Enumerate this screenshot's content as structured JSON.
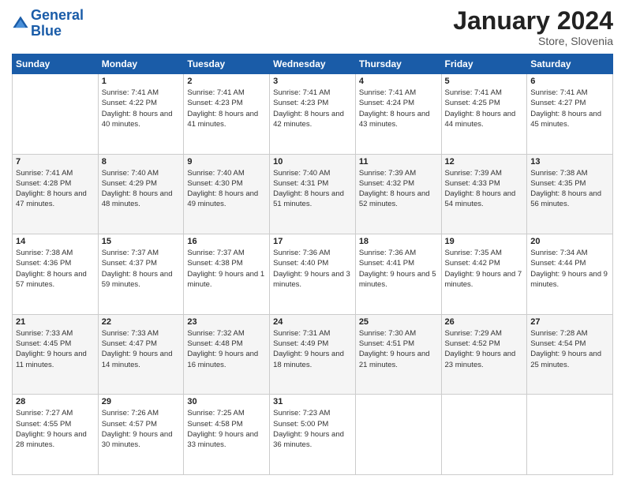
{
  "header": {
    "logo_general": "General",
    "logo_blue": "Blue",
    "month_year": "January 2024",
    "location": "Store, Slovenia"
  },
  "weekdays": [
    "Sunday",
    "Monday",
    "Tuesday",
    "Wednesday",
    "Thursday",
    "Friday",
    "Saturday"
  ],
  "weeks": [
    [
      {
        "day": "",
        "sunrise": "",
        "sunset": "",
        "daylight": ""
      },
      {
        "day": "1",
        "sunrise": "Sunrise: 7:41 AM",
        "sunset": "Sunset: 4:22 PM",
        "daylight": "Daylight: 8 hours and 40 minutes."
      },
      {
        "day": "2",
        "sunrise": "Sunrise: 7:41 AM",
        "sunset": "Sunset: 4:23 PM",
        "daylight": "Daylight: 8 hours and 41 minutes."
      },
      {
        "day": "3",
        "sunrise": "Sunrise: 7:41 AM",
        "sunset": "Sunset: 4:23 PM",
        "daylight": "Daylight: 8 hours and 42 minutes."
      },
      {
        "day": "4",
        "sunrise": "Sunrise: 7:41 AM",
        "sunset": "Sunset: 4:24 PM",
        "daylight": "Daylight: 8 hours and 43 minutes."
      },
      {
        "day": "5",
        "sunrise": "Sunrise: 7:41 AM",
        "sunset": "Sunset: 4:25 PM",
        "daylight": "Daylight: 8 hours and 44 minutes."
      },
      {
        "day": "6",
        "sunrise": "Sunrise: 7:41 AM",
        "sunset": "Sunset: 4:27 PM",
        "daylight": "Daylight: 8 hours and 45 minutes."
      }
    ],
    [
      {
        "day": "7",
        "sunrise": "Sunrise: 7:41 AM",
        "sunset": "Sunset: 4:28 PM",
        "daylight": "Daylight: 8 hours and 47 minutes."
      },
      {
        "day": "8",
        "sunrise": "Sunrise: 7:40 AM",
        "sunset": "Sunset: 4:29 PM",
        "daylight": "Daylight: 8 hours and 48 minutes."
      },
      {
        "day": "9",
        "sunrise": "Sunrise: 7:40 AM",
        "sunset": "Sunset: 4:30 PM",
        "daylight": "Daylight: 8 hours and 49 minutes."
      },
      {
        "day": "10",
        "sunrise": "Sunrise: 7:40 AM",
        "sunset": "Sunset: 4:31 PM",
        "daylight": "Daylight: 8 hours and 51 minutes."
      },
      {
        "day": "11",
        "sunrise": "Sunrise: 7:39 AM",
        "sunset": "Sunset: 4:32 PM",
        "daylight": "Daylight: 8 hours and 52 minutes."
      },
      {
        "day": "12",
        "sunrise": "Sunrise: 7:39 AM",
        "sunset": "Sunset: 4:33 PM",
        "daylight": "Daylight: 8 hours and 54 minutes."
      },
      {
        "day": "13",
        "sunrise": "Sunrise: 7:38 AM",
        "sunset": "Sunset: 4:35 PM",
        "daylight": "Daylight: 8 hours and 56 minutes."
      }
    ],
    [
      {
        "day": "14",
        "sunrise": "Sunrise: 7:38 AM",
        "sunset": "Sunset: 4:36 PM",
        "daylight": "Daylight: 8 hours and 57 minutes."
      },
      {
        "day": "15",
        "sunrise": "Sunrise: 7:37 AM",
        "sunset": "Sunset: 4:37 PM",
        "daylight": "Daylight: 8 hours and 59 minutes."
      },
      {
        "day": "16",
        "sunrise": "Sunrise: 7:37 AM",
        "sunset": "Sunset: 4:38 PM",
        "daylight": "Daylight: 9 hours and 1 minute."
      },
      {
        "day": "17",
        "sunrise": "Sunrise: 7:36 AM",
        "sunset": "Sunset: 4:40 PM",
        "daylight": "Daylight: 9 hours and 3 minutes."
      },
      {
        "day": "18",
        "sunrise": "Sunrise: 7:36 AM",
        "sunset": "Sunset: 4:41 PM",
        "daylight": "Daylight: 9 hours and 5 minutes."
      },
      {
        "day": "19",
        "sunrise": "Sunrise: 7:35 AM",
        "sunset": "Sunset: 4:42 PM",
        "daylight": "Daylight: 9 hours and 7 minutes."
      },
      {
        "day": "20",
        "sunrise": "Sunrise: 7:34 AM",
        "sunset": "Sunset: 4:44 PM",
        "daylight": "Daylight: 9 hours and 9 minutes."
      }
    ],
    [
      {
        "day": "21",
        "sunrise": "Sunrise: 7:33 AM",
        "sunset": "Sunset: 4:45 PM",
        "daylight": "Daylight: 9 hours and 11 minutes."
      },
      {
        "day": "22",
        "sunrise": "Sunrise: 7:33 AM",
        "sunset": "Sunset: 4:47 PM",
        "daylight": "Daylight: 9 hours and 14 minutes."
      },
      {
        "day": "23",
        "sunrise": "Sunrise: 7:32 AM",
        "sunset": "Sunset: 4:48 PM",
        "daylight": "Daylight: 9 hours and 16 minutes."
      },
      {
        "day": "24",
        "sunrise": "Sunrise: 7:31 AM",
        "sunset": "Sunset: 4:49 PM",
        "daylight": "Daylight: 9 hours and 18 minutes."
      },
      {
        "day": "25",
        "sunrise": "Sunrise: 7:30 AM",
        "sunset": "Sunset: 4:51 PM",
        "daylight": "Daylight: 9 hours and 21 minutes."
      },
      {
        "day": "26",
        "sunrise": "Sunrise: 7:29 AM",
        "sunset": "Sunset: 4:52 PM",
        "daylight": "Daylight: 9 hours and 23 minutes."
      },
      {
        "day": "27",
        "sunrise": "Sunrise: 7:28 AM",
        "sunset": "Sunset: 4:54 PM",
        "daylight": "Daylight: 9 hours and 25 minutes."
      }
    ],
    [
      {
        "day": "28",
        "sunrise": "Sunrise: 7:27 AM",
        "sunset": "Sunset: 4:55 PM",
        "daylight": "Daylight: 9 hours and 28 minutes."
      },
      {
        "day": "29",
        "sunrise": "Sunrise: 7:26 AM",
        "sunset": "Sunset: 4:57 PM",
        "daylight": "Daylight: 9 hours and 30 minutes."
      },
      {
        "day": "30",
        "sunrise": "Sunrise: 7:25 AM",
        "sunset": "Sunset: 4:58 PM",
        "daylight": "Daylight: 9 hours and 33 minutes."
      },
      {
        "day": "31",
        "sunrise": "Sunrise: 7:23 AM",
        "sunset": "Sunset: 5:00 PM",
        "daylight": "Daylight: 9 hours and 36 minutes."
      },
      {
        "day": "",
        "sunrise": "",
        "sunset": "",
        "daylight": ""
      },
      {
        "day": "",
        "sunrise": "",
        "sunset": "",
        "daylight": ""
      },
      {
        "day": "",
        "sunrise": "",
        "sunset": "",
        "daylight": ""
      }
    ]
  ]
}
